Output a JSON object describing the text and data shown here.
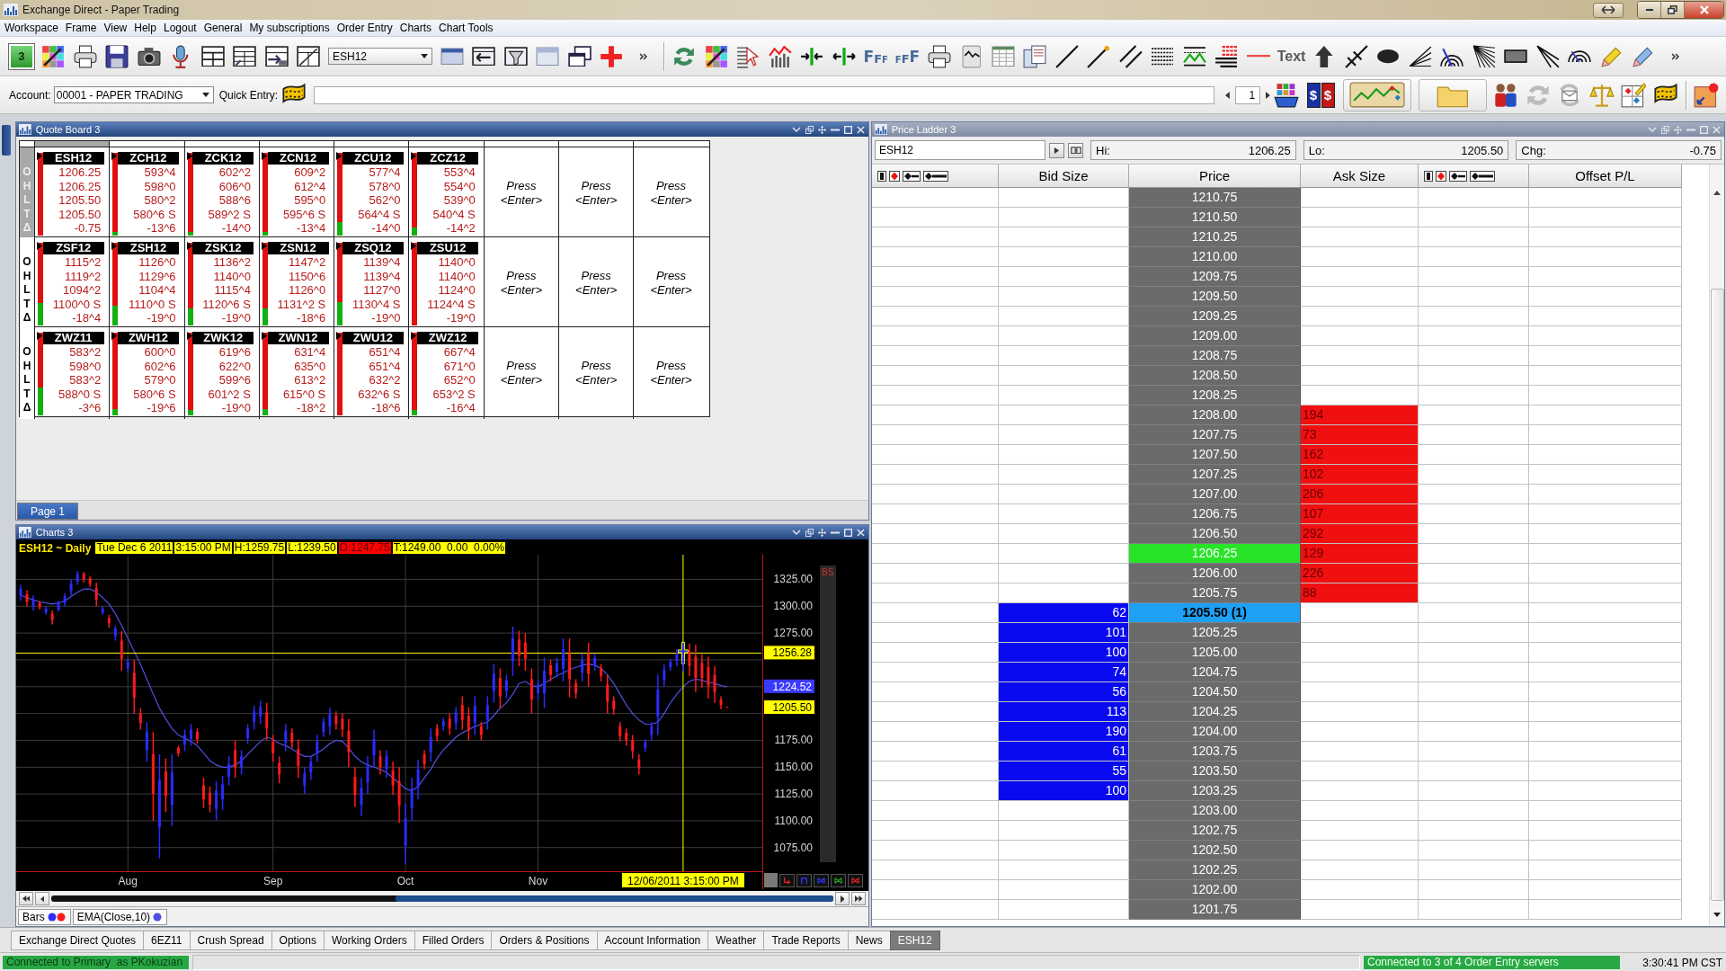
{
  "window": {
    "title": "Exchange Direct - Paper Trading"
  },
  "menu": [
    "Workspace",
    "Frame",
    "View",
    "Help",
    "Logout",
    "General",
    "My subscriptions",
    "Order Entry",
    "Charts",
    "Chart Tools"
  ],
  "toolbar": {
    "workspace": "3",
    "symbol": "ESH12",
    "font_buttons": [
      "FFF",
      "FFF"
    ],
    "text_tool": "Text"
  },
  "account_bar": {
    "account_label": "Account:",
    "account": "00001 - PAPER TRADING",
    "quick_entry_label": "Quick Entry:",
    "page": "1",
    "currency_badges": [
      "$",
      "$"
    ]
  },
  "quote_board": {
    "title": "Quote Board 3",
    "active": true,
    "rows": [
      {
        "labels": [
          "O",
          "H",
          "L",
          "T",
          "Δ"
        ],
        "cells": [
          {
            "kind": "quote",
            "symbol": "ESH12",
            "values": [
              "1206.25",
              "1206.25",
              "1205.50",
              "1205.50",
              "-0.75"
            ],
            "level": 0,
            "selected": true
          },
          {
            "kind": "quote",
            "symbol": "ZCH12",
            "values": [
              "593^4",
              "598^0",
              "580^2",
              "580^6 S",
              "-13^6"
            ],
            "level": 0.04,
            "selected": false
          },
          {
            "kind": "quote",
            "symbol": "ZCK12",
            "values": [
              "602^2",
              "606^0",
              "588^6",
              "589^2 S",
              "-14^0"
            ],
            "level": 0.04,
            "selected": false
          },
          {
            "kind": "quote",
            "symbol": "ZCN12",
            "values": [
              "609^2",
              "612^4",
              "595^0",
              "595^6 S",
              "-13^4"
            ],
            "level": 0.04,
            "selected": false
          },
          {
            "kind": "quote",
            "symbol": "ZCU12",
            "values": [
              "577^4",
              "578^0",
              "562^0",
              "564^4 S",
              "-14^0"
            ],
            "level": 0.16,
            "selected": false
          },
          {
            "kind": "quote",
            "symbol": "ZCZ12",
            "values": [
              "553^4",
              "554^0",
              "539^0",
              "540^4 S",
              "-14^2"
            ],
            "level": 0.1,
            "selected": false
          },
          {
            "kind": "prompt",
            "text": "Press <Enter>"
          },
          {
            "kind": "prompt",
            "text": "Press <Enter>"
          },
          {
            "kind": "prompt",
            "text": "Press <Enter>"
          }
        ]
      },
      {
        "labels": [
          "O",
          "H",
          "L",
          "T",
          "Δ"
        ],
        "cells": [
          {
            "kind": "quote",
            "symbol": "ZSF12",
            "values": [
              "1115^2",
              "1119^2",
              "1094^2",
              "1100^0 S",
              "-18^4"
            ],
            "level": 0.27,
            "selected": false
          },
          {
            "kind": "quote",
            "symbol": "ZSH12",
            "values": [
              "1126^0",
              "1129^6",
              "1104^4",
              "1110^0 S",
              "-19^0"
            ],
            "level": 0.24,
            "selected": false
          },
          {
            "kind": "quote",
            "symbol": "ZSK12",
            "values": [
              "1136^2",
              "1140^0",
              "1115^4",
              "1120^6 S",
              "-19^0"
            ],
            "level": 0.21,
            "selected": false
          },
          {
            "kind": "quote",
            "symbol": "ZSN12",
            "values": [
              "1147^2",
              "1150^6",
              "1126^0",
              "1131^2 S",
              "-18^6"
            ],
            "level": 0.21,
            "selected": false
          },
          {
            "kind": "quote",
            "symbol": "ZSQ12",
            "values": [
              "1139^4",
              "1139^4",
              "1127^0",
              "1130^4 S",
              "-19^0"
            ],
            "level": 0.28,
            "selected": false
          },
          {
            "kind": "quote",
            "symbol": "ZSU12",
            "values": [
              "1140^0",
              "1140^0",
              "1124^0",
              "1124^4 S",
              "-19^0"
            ],
            "level": 0,
            "selected": false
          },
          {
            "kind": "prompt",
            "text": "Press <Enter>"
          },
          {
            "kind": "prompt",
            "text": "Press <Enter>"
          },
          {
            "kind": "prompt",
            "text": "Press <Enter>"
          }
        ]
      },
      {
        "labels": [
          "O",
          "H",
          "L",
          "T",
          "Δ"
        ],
        "cells": [
          {
            "kind": "quote",
            "symbol": "ZWZ11",
            "values": [
              "583^2",
              "598^0",
              "583^2",
              "588^0 S",
              "-3^6"
            ],
            "level": 0.34,
            "selected": false
          },
          {
            "kind": "quote",
            "symbol": "ZWH12",
            "values": [
              "600^0",
              "602^6",
              "579^0",
              "580^6 S",
              "-19^6"
            ],
            "level": 0.08,
            "selected": false
          },
          {
            "kind": "quote",
            "symbol": "ZWK12",
            "values": [
              "619^6",
              "622^0",
              "599^6",
              "601^2 S",
              "-19^0"
            ],
            "level": 0.07,
            "selected": false
          },
          {
            "kind": "quote",
            "symbol": "ZWN12",
            "values": [
              "631^4",
              "635^0",
              "613^2",
              "615^0 S",
              "-18^2"
            ],
            "level": 0.08,
            "selected": false
          },
          {
            "kind": "quote",
            "symbol": "ZWU12",
            "values": [
              "651^4",
              "651^4",
              "632^2",
              "632^6 S",
              "-18^6"
            ],
            "level": 0,
            "selected": false
          },
          {
            "kind": "quote",
            "symbol": "ZWZ12",
            "values": [
              "667^4",
              "671^0",
              "652^0",
              "653^2 S",
              "-16^4"
            ],
            "level": 0.07,
            "selected": false
          },
          {
            "kind": "prompt",
            "text": "Press <Enter>"
          },
          {
            "kind": "prompt",
            "text": "Press <Enter>"
          },
          {
            "kind": "prompt",
            "text": "Press <Enter>"
          }
        ]
      }
    ],
    "pages": [
      {
        "label": "Page 1",
        "selected": true
      }
    ]
  },
  "chart_panel": {
    "title": "Charts 3",
    "active": true,
    "header": "ESH12 ~ Daily",
    "info": [
      {
        "text": "Tue Dec 6 2011",
        "color": "#ffff00"
      },
      {
        "text": "3:15:00 PM",
        "color": "#ffff00"
      },
      {
        "text": "H:1259.75",
        "color": "#ffff00"
      },
      {
        "text": "L:1239.50",
        "color": "#ffff00"
      },
      {
        "text": "O:1247.75",
        "color": "#ff0000"
      },
      {
        "text": "T:1249.00  0.00  0.00%",
        "color": "#ffff00"
      }
    ],
    "strip_label": "BS",
    "tags": [
      {
        "kind": "date",
        "text": "12/06/2011 3:15:00 PM",
        "color": "#ffff00"
      },
      {
        "kind": "ema",
        "text": "1224.52",
        "color": "#3a3aff"
      },
      {
        "kind": "last",
        "text": "1205.50",
        "color": "#ffff00"
      }
    ],
    "chart_data": [
      {
        "type": "candlestick",
        "categories": [
          null,
          null,
          null,
          null,
          null,
          null,
          null,
          null,
          null,
          null,
          null,
          null,
          null,
          null,
          null,
          null,
          null,
          "Aug",
          null,
          null,
          null,
          null,
          null,
          null,
          null,
          null,
          null,
          null,
          null,
          null,
          null,
          null,
          null,
          null,
          null,
          null,
          null,
          null,
          null,
          null,
          "Sep",
          null,
          null,
          null,
          null,
          null,
          null,
          null,
          null,
          null,
          null,
          null,
          null,
          null,
          null,
          null,
          null,
          null,
          null,
          null,
          null,
          "Oct",
          null,
          null,
          null,
          null,
          null,
          null,
          null,
          null,
          null,
          null,
          null,
          null,
          null,
          null,
          null,
          null,
          null,
          null,
          null,
          null,
          "Nov",
          null,
          null,
          null,
          null,
          null,
          null,
          null,
          null,
          null,
          null,
          null,
          null,
          null,
          null,
          null,
          null,
          null,
          null,
          null,
          null,
          null,
          null,
          null,
          null,
          null,
          null,
          null,
          null,
          null,
          null
        ],
        "ylim": [
          1053,
          1348
        ],
        "yticks": [
          {
            "value": 1075,
            "label": "1075.00"
          },
          {
            "value": 1100,
            "label": "1100.00"
          },
          {
            "value": 1125,
            "label": "1125.00"
          },
          {
            "value": 1150,
            "label": "1150.00"
          },
          {
            "value": 1175,
            "label": "1175.00"
          },
          {
            "value": 1275,
            "label": "1275.00"
          },
          {
            "value": 1300,
            "label": "1300.00"
          },
          {
            "value": 1325,
            "label": "1325.00"
          }
        ],
        "grid": true,
        "series": [
          {
            "name": "Bars",
            "ohlc": [
              [
                1310,
                1320,
                1305,
                1316
              ],
              [
                1311,
                1315,
                1300,
                1304
              ],
              [
                1300,
                1310,
                1296,
                1306
              ],
              [
                1303,
                1305,
                1297,
                1299
              ],
              [
                1294,
                1300,
                1292,
                1298
              ],
              [
                1293,
                1296,
                1283,
                1287
              ],
              [
                1297,
                1305,
                1295,
                1303
              ],
              [
                1303,
                1312,
                1300,
                1309
              ],
              [
                1314,
                1325,
                1310,
                1321
              ],
              [
                1323,
                1333,
                1320,
                1330
              ],
              [
                1330,
                1332,
                1322,
                1325
              ],
              [
                1326,
                1328,
                1318,
                1321
              ],
              [
                1317,
                1322,
                1300,
                1306
              ],
              [
                1294,
                1300,
                1292,
                1298
              ],
              [
                1289,
                1292,
                1280,
                1284
              ],
              [
                1272,
                1282,
                1268,
                1279
              ],
              [
                1268,
                1277,
                1240,
                1251
              ],
              [
                1242,
                1252,
                1238,
                1248
              ],
              [
                1238,
                1250,
                1200,
                1215
              ],
              [
                1200,
                1205,
                1185,
                1191
              ],
              [
                1166,
                1192,
                1155,
                1183
              ],
              [
                1162,
                1183,
                1100,
                1125
              ],
              [
                1094,
                1162,
                1065,
                1138
              ],
              [
                1146,
                1158,
                1108,
                1123
              ],
              [
                1115,
                1162,
                1095,
                1145
              ],
              [
                1168,
                1170,
                1160,
                1163
              ],
              [
                1171,
                1185,
                1165,
                1180
              ],
              [
                1176,
                1190,
                1170,
                1185
              ],
              [
                1183,
                1186,
                1172,
                1176
              ],
              [
                1133,
                1140,
                1112,
                1120
              ],
              [
                1126,
                1132,
                1108,
                1115
              ],
              [
                1111,
                1137,
                1100,
                1128
              ],
              [
                1120,
                1142,
                1110,
                1134
              ],
              [
                1141,
                1160,
                1133,
                1153
              ],
              [
                1166,
                1175,
                1140,
                1150
              ],
              [
                1150,
                1166,
                1143,
                1160
              ],
              [
                1177,
                1190,
                1172,
                1186
              ],
              [
                1192,
                1207,
                1185,
                1202
              ],
              [
                1197,
                1212,
                1190,
                1206
              ],
              [
                1201,
                1210,
                1175,
                1186
              ],
              [
                1174,
                1180,
                1155,
                1163
              ],
              [
                1154,
                1160,
                1135,
                1143
              ],
              [
                1173,
                1190,
                1165,
                1184
              ],
              [
                1182,
                1186,
                1168,
                1173
              ],
              [
                1167,
                1176,
                1140,
                1151
              ],
              [
                1133,
                1150,
                1125,
                1144
              ],
              [
                1145,
                1160,
                1138,
                1155
              ],
              [
                1163,
                1180,
                1155,
                1174
              ],
              [
                1183,
                1196,
                1178,
                1192
              ],
              [
                1188,
                1205,
                1180,
                1199
              ],
              [
                1198,
                1202,
                1185,
                1190
              ],
              [
                1195,
                1200,
                1178,
                1185
              ],
              [
                1184,
                1195,
                1150,
                1164
              ],
              [
                1141,
                1150,
                1113,
                1124
              ],
              [
                1115,
                1140,
                1104,
                1131
              ],
              [
                1136,
                1160,
                1125,
                1151
              ],
              [
                1161,
                1185,
                1150,
                1176
              ],
              [
                1160,
                1166,
                1143,
                1150
              ],
              [
                1148,
                1166,
                1140,
                1160
              ],
              [
                1147,
                1155,
                1124,
                1133
              ],
              [
                1137,
                1150,
                1098,
                1114
              ],
              [
                1077,
                1116,
                1060,
                1102
              ],
              [
                1112,
                1140,
                1100,
                1130
              ],
              [
                1131,
                1157,
                1120,
                1148
              ],
              [
                1162,
                1166,
                1148,
                1153
              ],
              [
                1164,
                1186,
                1155,
                1178
              ],
              [
                1186,
                1190,
                1174,
                1179
              ],
              [
                1188,
                1196,
                1184,
                1193
              ],
              [
                1195,
                1200,
                1180,
                1186
              ],
              [
                1191,
                1206,
                1185,
                1201
              ],
              [
                1208,
                1216,
                1185,
                1194
              ],
              [
                1198,
                1206,
                1175,
                1184
              ],
              [
                1191,
                1216,
                1180,
                1207
              ],
              [
                1188,
                1192,
                1175,
                1180
              ],
              [
                1194,
                1216,
                1185,
                1208
              ],
              [
                1221,
                1246,
                1210,
                1237
              ],
              [
                1233,
                1242,
                1205,
                1216
              ],
              [
                1221,
                1236,
                1214,
                1231
              ],
              [
                1249,
                1281,
                1235,
                1270
              ],
              [
                1269,
                1277,
                1244,
                1254
              ],
              [
                1266,
                1275,
                1240,
                1251
              ],
              [
                1232,
                1242,
                1200,
                1213
              ],
              [
                1219,
                1232,
                1213,
                1227
              ],
              [
                1219,
                1252,
                1205,
                1240
              ],
              [
                1245,
                1250,
                1230,
                1236
              ],
              [
                1239,
                1252,
                1234,
                1247
              ],
              [
                1242,
                1270,
                1230,
                1260
              ],
              [
                1256,
                1270,
                1215,
                1232
              ],
              [
                1228,
                1232,
                1214,
                1219
              ],
              [
                1238,
                1256,
                1230,
                1250
              ],
              [
                1256,
                1266,
                1225,
                1237
              ],
              [
                1245,
                1256,
                1240,
                1252
              ],
              [
                1242,
                1246,
                1230,
                1235
              ],
              [
                1227,
                1236,
                1200,
                1211
              ],
              [
                1212,
                1216,
                1199,
                1204
              ],
              [
                1188,
                1192,
                1174,
                1179
              ],
              [
                1182,
                1186,
                1170,
                1175
              ],
              [
                1175,
                1180,
                1158,
                1165
              ],
              [
                1157,
                1162,
                1143,
                1149
              ],
              [
                1168,
                1176,
                1164,
                1173
              ],
              [
                1180,
                1192,
                1175,
                1188
              ],
              [
                1197,
                1236,
                1180,
                1222
              ],
              [
                1231,
                1246,
                1225,
                1241
              ],
              [
                1243,
                1251,
                1240,
                1248
              ],
              [
                1249,
                1260,
                1244,
                1256
              ],
              [
                1247.75,
                1259.75,
                1239.5,
                1249
              ],
              [
                1258,
                1265,
                1235,
                1244
              ],
              [
                1253,
                1264,
                1220,
                1233
              ],
              [
                1247,
                1255,
                1224,
                1233
              ],
              [
                1243,
                1253,
                1214,
                1226
              ],
              [
                1236,
                1244,
                1210,
                1220
              ],
              [
                1213,
                1216,
                1204,
                1208
              ],
              [
                1206.25,
                1206.25,
                1205.5,
                1205.5
              ]
            ]
          },
          {
            "name": "EMA(Close,10)",
            "type": "line",
            "color": "#5050e0",
            "values": [
              1310,
              1308,
              1306,
              1304,
              1303,
              1302,
              1303,
              1305,
              1309,
              1313,
              1316,
              1316,
              1313,
              1308,
              1302,
              1293,
              1282,
              1270,
              1258,
              1246,
              1232,
              1218,
              1205,
              1195,
              1186,
              1180,
              1177,
              1174,
              1170,
              1163,
              1156,
              1152,
              1150,
              1150,
              1152,
              1156,
              1162,
              1168,
              1174,
              1178,
              1176,
              1172,
              1170,
              1167,
              1163,
              1160,
              1160,
              1163,
              1167,
              1172,
              1175,
              1174,
              1168,
              1160,
              1155,
              1152,
              1150,
              1148,
              1145,
              1140,
              1135,
              1130,
              1128,
              1132,
              1140,
              1148,
              1158,
              1166,
              1172,
              1178,
              1182,
              1185,
              1188,
              1190,
              1192,
              1198,
              1205,
              1210,
              1218,
              1228,
              1230,
              1226,
              1225,
              1228,
              1232,
              1235,
              1238,
              1241,
              1243,
              1245,
              1246,
              1245,
              1242,
              1236,
              1228,
              1218,
              1208,
              1200,
              1194,
              1190,
              1190,
              1192,
              1200,
              1210,
              1218,
              1225,
              1230,
              1232,
              1231,
              1229,
              1228,
              1226,
              1225
            ]
          }
        ],
        "ref_lines": [
          {
            "axis": "y",
            "value": 1256.28,
            "label": "1256.28",
            "color": "#ffff00"
          }
        ]
      }
    ]
  },
  "price_ladder": {
    "title": "Price Ladder 3",
    "active": false,
    "symbol": "ESH12",
    "stats": [
      {
        "label": "Hi:",
        "value": "1206.25"
      },
      {
        "label": "Lo:",
        "value": "1205.50"
      },
      {
        "label": "Chg:",
        "value": "-0.75"
      }
    ],
    "columns": [
      {
        "kind": "order_icons"
      },
      {
        "kind": "bid",
        "label": "Bid Size"
      },
      {
        "kind": "price",
        "label": "Price"
      },
      {
        "kind": "ask",
        "label": "Ask Size"
      },
      {
        "kind": "order_icons"
      },
      {
        "kind": "pl",
        "label": "Offset P/L"
      }
    ],
    "rows": [
      {
        "price": "1210.75",
        "kind": "plain"
      },
      {
        "price": "1210.50",
        "kind": "plain"
      },
      {
        "price": "1210.25",
        "kind": "plain"
      },
      {
        "price": "1210.00",
        "kind": "plain"
      },
      {
        "price": "1209.75",
        "kind": "plain"
      },
      {
        "price": "1209.50",
        "kind": "plain"
      },
      {
        "price": "1209.25",
        "kind": "plain"
      },
      {
        "price": "1209.00",
        "kind": "plain"
      },
      {
        "price": "1208.75",
        "kind": "plain"
      },
      {
        "price": "1208.50",
        "kind": "plain"
      },
      {
        "price": "1208.25",
        "kind": "plain"
      },
      {
        "price": "1208.00",
        "ask": "194",
        "kind": "plain"
      },
      {
        "price": "1207.75",
        "ask": "73",
        "kind": "plain"
      },
      {
        "price": "1207.50",
        "ask": "162",
        "kind": "plain"
      },
      {
        "price": "1207.25",
        "ask": "102",
        "kind": "plain"
      },
      {
        "price": "1207.00",
        "ask": "206",
        "kind": "plain"
      },
      {
        "price": "1206.75",
        "ask": "107",
        "kind": "plain"
      },
      {
        "price": "1206.50",
        "ask": "292",
        "kind": "plain"
      },
      {
        "price": "1206.25",
        "ask": "129",
        "kind": "high"
      },
      {
        "price": "1206.00",
        "ask": "226",
        "kind": "plain"
      },
      {
        "price": "1205.75",
        "ask": "88",
        "kind": "plain"
      },
      {
        "price": "1205.50 (1)",
        "bid": "62",
        "kind": "last"
      },
      {
        "price": "1205.25",
        "bid": "101",
        "kind": "plain"
      },
      {
        "price": "1205.00",
        "bid": "100",
        "kind": "plain"
      },
      {
        "price": "1204.75",
        "bid": "74",
        "kind": "plain"
      },
      {
        "price": "1204.50",
        "bid": "56",
        "kind": "plain"
      },
      {
        "price": "1204.25",
        "bid": "113",
        "kind": "plain"
      },
      {
        "price": "1204.00",
        "bid": "190",
        "kind": "plain"
      },
      {
        "price": "1203.75",
        "bid": "61",
        "kind": "plain"
      },
      {
        "price": "1203.50",
        "bid": "55",
        "kind": "plain"
      },
      {
        "price": "1203.25",
        "bid": "100",
        "kind": "plain"
      },
      {
        "price": "1203.00",
        "kind": "plain"
      },
      {
        "price": "1202.75",
        "kind": "plain"
      },
      {
        "price": "1202.50",
        "kind": "plain"
      },
      {
        "price": "1202.25",
        "kind": "plain"
      },
      {
        "price": "1202.00",
        "kind": "plain"
      },
      {
        "price": "1201.75",
        "kind": "plain"
      }
    ]
  },
  "tabs": [
    {
      "label": "Exchange Direct Quotes",
      "selected": false
    },
    {
      "label": "6EZ11",
      "selected": false
    },
    {
      "label": "Crush Spread",
      "selected": false
    },
    {
      "label": "Options",
      "selected": false
    },
    {
      "label": "Working Orders",
      "selected": false
    },
    {
      "label": "Filled Orders",
      "selected": false
    },
    {
      "label": "Orders & Positions",
      "selected": false
    },
    {
      "label": "Account Information",
      "selected": false
    },
    {
      "label": "Weather",
      "selected": false
    },
    {
      "label": "Trade Reports",
      "selected": false
    },
    {
      "label": "News",
      "selected": false
    },
    {
      "label": "ESH12",
      "selected": true
    }
  ],
  "status_bar": {
    "connection": "Connected to Primary  as PKokuzian",
    "servers": "Connected to 3 of 4 Order Entry servers",
    "time": "3:30:41 PM CST"
  }
}
